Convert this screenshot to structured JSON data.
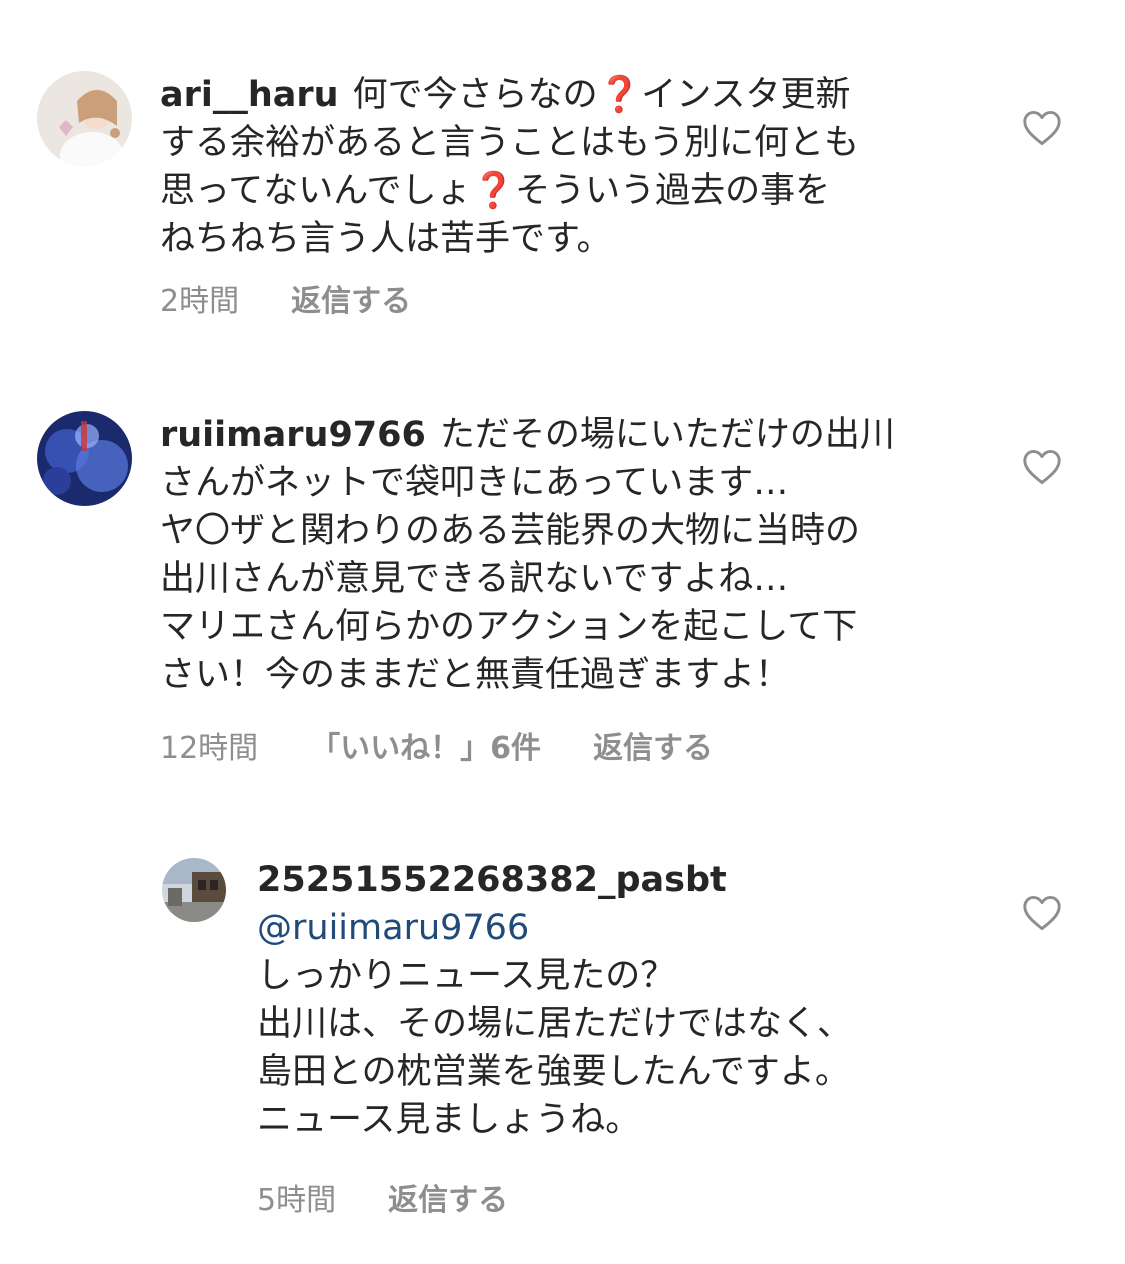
{
  "comments": [
    {
      "username": "ari__haru",
      "avatar_icon": "user-avatar",
      "text": {
        "l1a": "何で今さらなの",
        "l1q": "❓",
        "l1b": "インスタ更新",
        "l2": "する余裕があると言うことはもう別に何とも",
        "l3a": "思ってないんでしょ",
        "l3q": "❓",
        "l3b": "そういう過去の事を",
        "l4": "ねちねち言う人は苦手です。"
      },
      "time": "2時間",
      "reply_label": "返信する"
    },
    {
      "username": "ruiimaru9766",
      "avatar_icon": "user-avatar",
      "text": {
        "l1": "ただその場にいただけの出川",
        "l2": "さんがネットで袋叩きにあっています…",
        "l3": "ヤ〇ザと関わりのある芸能界の大物に当時の",
        "l4": "出川さんが意見できる訳ないですよね…",
        "l5": "マリエさん何らかのアクションを起こして下",
        "l6": "さい！今のままだと無責任過ぎますよ！"
      },
      "time": "12時間",
      "likes_label": "「いいね！」6件",
      "reply_label": "返信する"
    },
    {
      "username": "25251552268382_pasbt",
      "avatar_icon": "user-avatar",
      "mention": "@ruiimaru9766",
      "text": {
        "l1": "しっかりニュース見たの？",
        "l2": "出川は、その場に居ただけではなく、",
        "l3": "島田との枕営業を強要したんですよ。",
        "l4": "ニュース見ましょうね。"
      },
      "time": "5時間",
      "reply_label": "返信する"
    }
  ],
  "icons": {
    "like": "heart-outline-icon"
  },
  "colors": {
    "text": "#262626",
    "meta": "#8e8e8e",
    "mention": "#1f4a7a",
    "question_mark": "#d6242a"
  }
}
